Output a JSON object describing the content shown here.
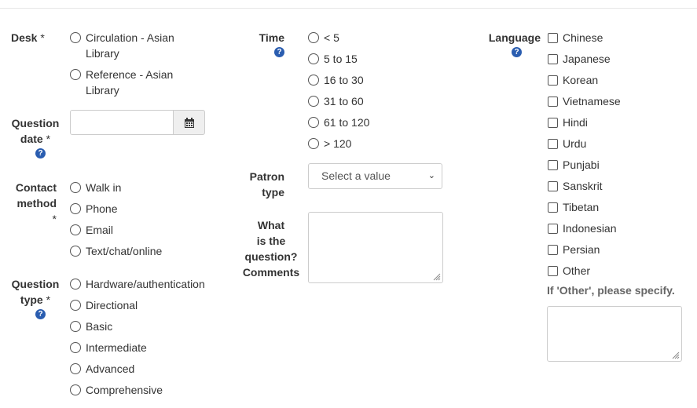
{
  "desk": {
    "label": "Desk",
    "required": "*",
    "options": [
      "Circulation - Asian",
      "Library",
      "Reference - Asian",
      "Library"
    ]
  },
  "question_date": {
    "label_line1": "Question",
    "label_line2": "date",
    "required": "*",
    "value": "",
    "calendar_icon": "calendar-icon"
  },
  "contact_method": {
    "label_line1": "Contact",
    "label_line2": "method",
    "required": "*",
    "options": [
      "Walk in",
      "Phone",
      "Email",
      "Text/chat/online"
    ]
  },
  "question_type": {
    "label_line1": "Question",
    "label_line2": "type",
    "required": "*",
    "options": [
      "Hardware/authentication",
      "Directional",
      "Basic",
      "Intermediate",
      "Advanced",
      "Comprehensive"
    ]
  },
  "time": {
    "label": "Time",
    "options": [
      "< 5",
      "5 to 15",
      "16 to 30",
      "31 to 60",
      "61 to 120",
      "> 120"
    ]
  },
  "patron_type": {
    "label_line1": "Patron",
    "label_line2": "type",
    "placeholder": "Select a value"
  },
  "question_text": {
    "label_lines": [
      "What",
      "is the",
      "question?",
      "Comments"
    ],
    "value": ""
  },
  "language": {
    "label": "Language",
    "options": [
      "Chinese",
      "Japanese",
      "Korean",
      "Vietnamese",
      "Hindi",
      "Urdu",
      "Punjabi",
      "Sanskrit",
      "Tibetan",
      "Indonesian",
      "Persian",
      "Other"
    ],
    "other_label": "If 'Other', please specify.",
    "other_value": ""
  },
  "help_icon": "?",
  "colors": {
    "help": "#2a5db0",
    "border": "#cccccc",
    "text": "#333333"
  }
}
